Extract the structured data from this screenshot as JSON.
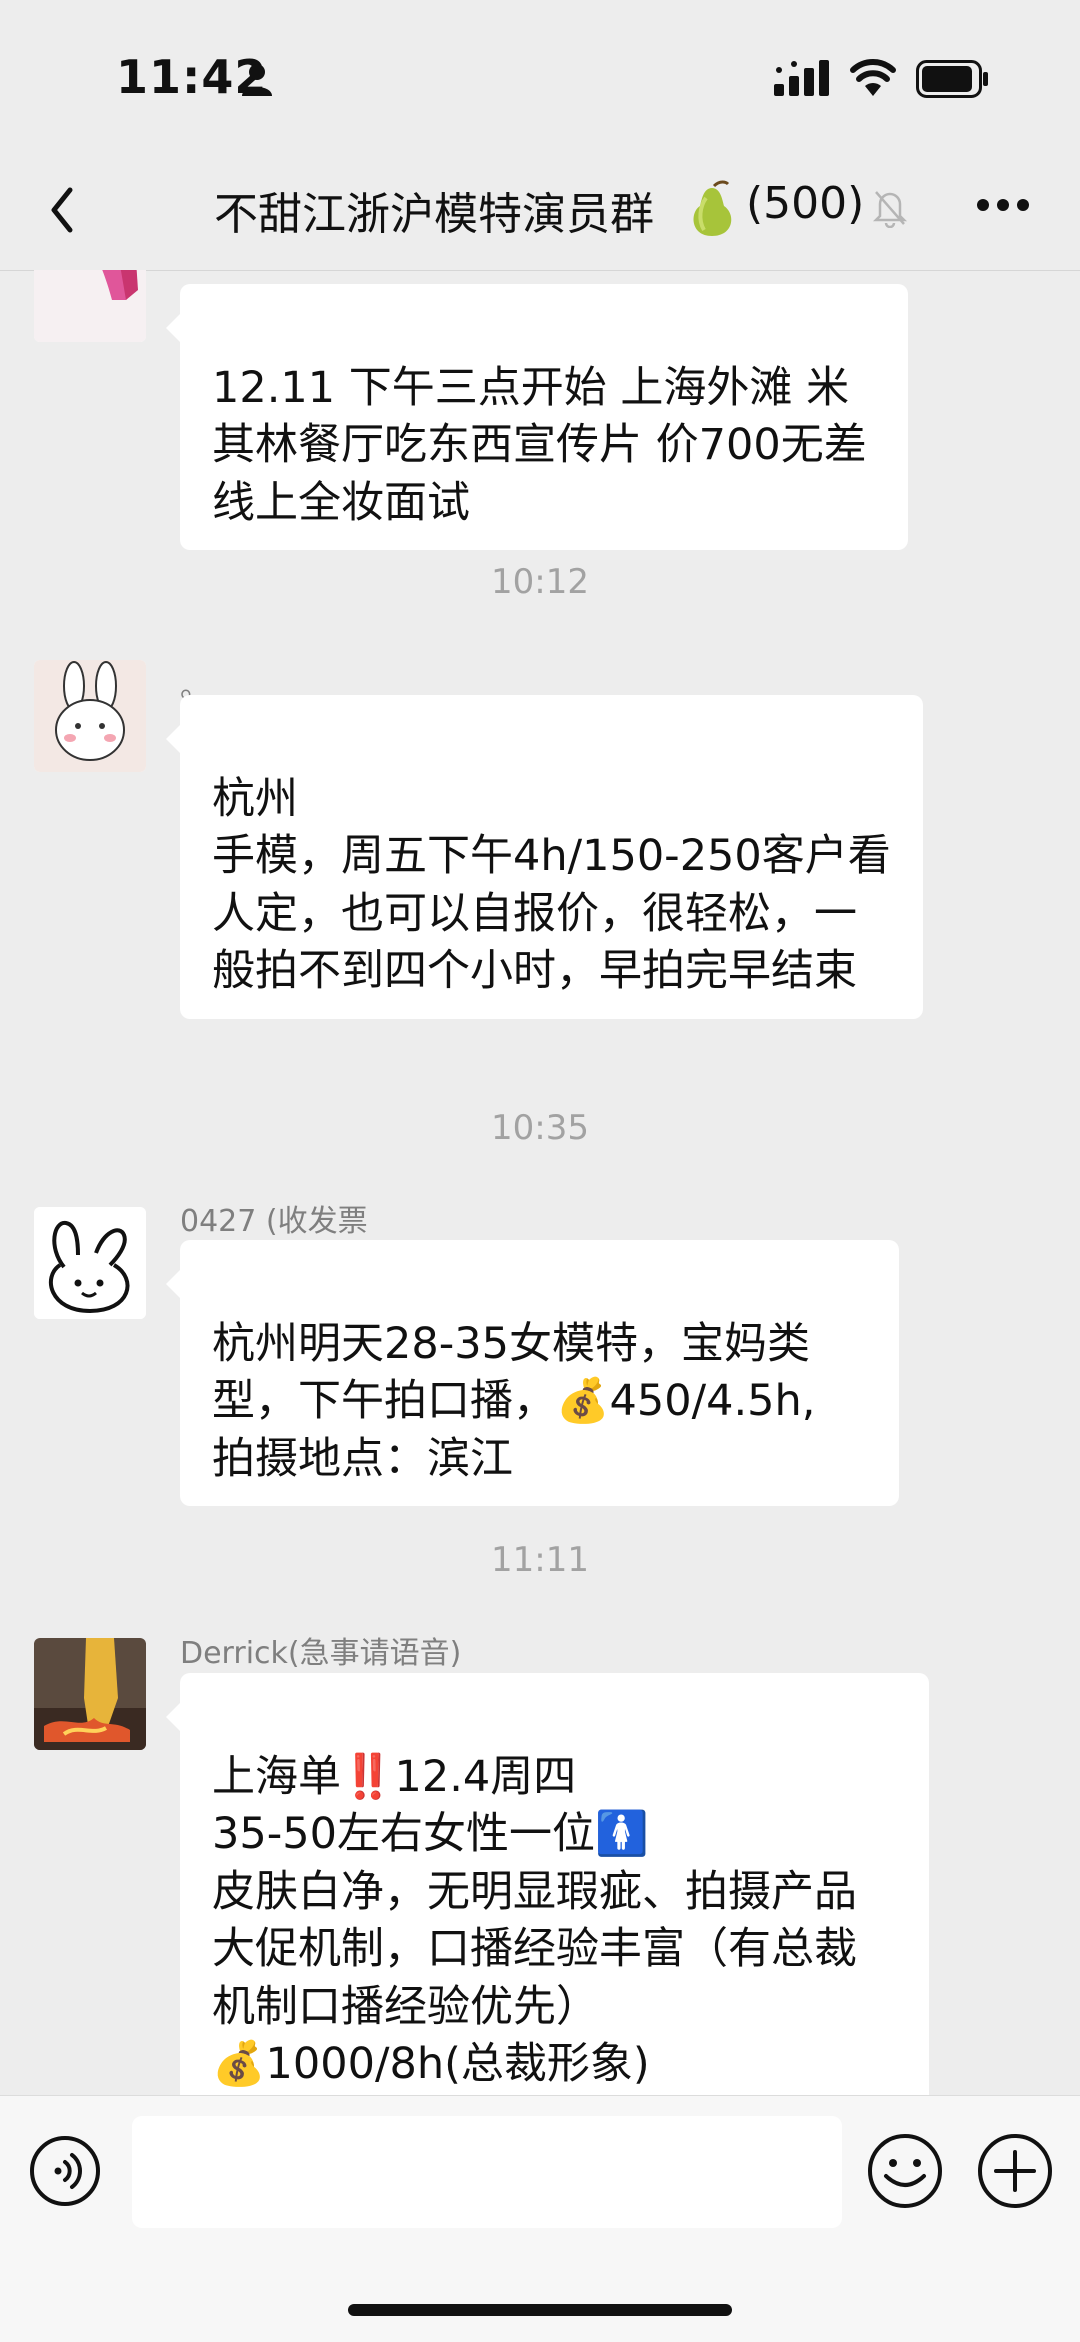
{
  "status_bar": {
    "time": "11:42"
  },
  "nav": {
    "title": "不甜江浙沪模特演员群",
    "title_emoji": "pear-icon",
    "member_count": "(500)"
  },
  "messages": [
    {
      "text": "12.11  下午三点开始 上海外滩 米其林餐厅吃东西宣传片 价700无差 线上全妆面试"
    },
    {
      "time": "10:12",
      "sender": "。",
      "text": "杭州\n手模，周五下午4h/150-250客户看人定，也可以自报价，很轻松，一般拍不到四个小时，早拍完早结束"
    },
    {
      "time": "10:35",
      "sender": "0427 (收发票",
      "text": "杭州明天28-35女模特，宝妈类型，下午拍口播，💰450/4.5h, 拍摄地点：滨江"
    },
    {
      "time": "11:11",
      "sender": "Derrick(急事请语音)",
      "text": "上海单‼️12.4周四\n35-50左右女性一位🚺\n皮肤白净，无明显瑕疵、拍摄产品大促机制，口播经验丰富（有总裁机制口播经验优先）\n💰1000/8h(总裁形象)\n报名发相关资料口播"
    }
  ],
  "input": {
    "placeholder": ""
  },
  "colors": {
    "background": "#ededed",
    "bubble": "#ffffff",
    "timestamp": "#a2a2a2",
    "sender": "#7f7f7f"
  }
}
